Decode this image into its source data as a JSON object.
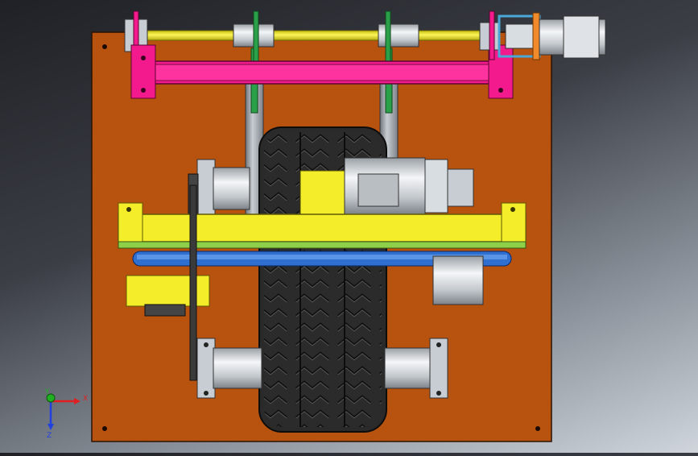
{
  "viewport": {
    "background_top": "#1f2126",
    "background_bottom": "#cfd5db"
  },
  "model": {
    "base_plate_color": "#b8520f",
    "shaft_color": "#f2ea1a",
    "bracket_color": "#f21a8c",
    "frame_color": "#f4ee2a",
    "motor_color": "#cfd3d7",
    "tire_color": "#2a2a2a",
    "belt_color": "#2f6fd0",
    "coupling_color": "#4aa8d8"
  },
  "triad": {
    "x_label": "X",
    "y_label": "Y",
    "z_label": "Z",
    "x_color": "#e02020",
    "y_color": "#20b020",
    "z_color": "#2040e0"
  }
}
